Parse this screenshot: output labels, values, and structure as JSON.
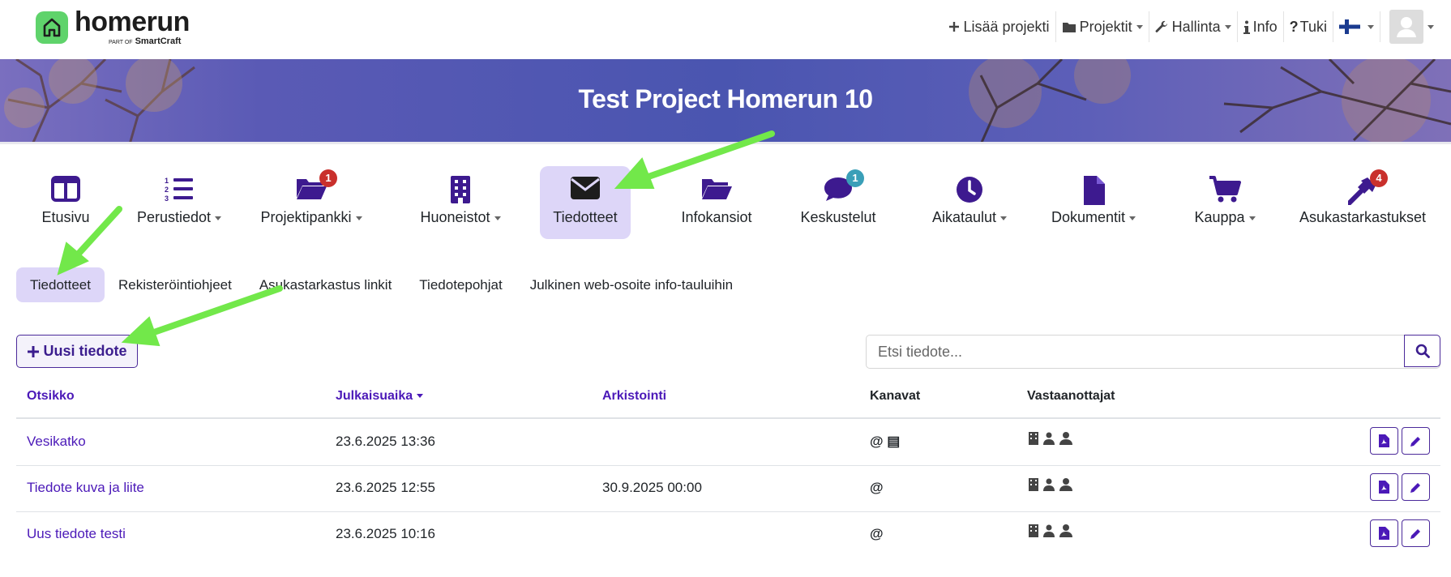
{
  "brand": {
    "name": "homerun",
    "part_of": "PART OF",
    "parent": "SmartCraft"
  },
  "topnav": {
    "add_project": "Lisää projekti",
    "projects": "Projektit",
    "admin": "Hallinta",
    "info": "Info",
    "support": "Tuki",
    "language_icon": "finland-flag-icon",
    "user_icon": "user-avatar-icon"
  },
  "project_title": "Test Project Homerun 10",
  "modules": [
    {
      "label": "Etusivu",
      "icon": "columns-icon",
      "dropdown": false
    },
    {
      "label": "Perustiedot",
      "icon": "numbered-list-icon",
      "dropdown": true
    },
    {
      "label": "Projektipankki",
      "icon": "folder-open-icon",
      "dropdown": true,
      "badge": "1"
    },
    {
      "label": "Huoneistot",
      "icon": "building-icon",
      "dropdown": true
    },
    {
      "label": "Tiedotteet",
      "icon": "envelope-icon",
      "dropdown": false,
      "active": true
    },
    {
      "label": "Infokansiot",
      "icon": "folder-open-icon",
      "dropdown": false
    },
    {
      "label": "Keskustelut",
      "icon": "comment-icon",
      "dropdown": false,
      "badge": "1"
    },
    {
      "label": "Aikataulut",
      "icon": "clock-icon",
      "dropdown": true
    },
    {
      "label": "Dokumentit",
      "icon": "file-icon",
      "dropdown": true
    },
    {
      "label": "Kauppa",
      "icon": "cart-icon",
      "dropdown": true
    },
    {
      "label": "Asukastarkastukset",
      "icon": "hammer-icon",
      "dropdown": false,
      "badge": "4"
    }
  ],
  "subnav": [
    "Tiedotteet",
    "Rekisteröintiohjeet",
    "Asukastarkastus linkit",
    "Tiedotepohjat",
    "Julkinen web-osoite info-tauluihin"
  ],
  "new_button": "Uusi tiedote",
  "search": {
    "placeholder": "Etsi tiedote..."
  },
  "table": {
    "headers": {
      "title": "Otsikko",
      "published": "Julkaisuaika",
      "archive": "Arkistointi",
      "channels": "Kanavat",
      "recipients": "Vastaanottajat"
    },
    "rows": [
      {
        "title": "Vesikatko",
        "published": "23.6.2025 13:36",
        "archive": "",
        "channels": "@ ▤"
      },
      {
        "title": "Tiedote kuva ja liite",
        "published": "23.6.2025 12:55",
        "archive": "30.9.2025 00:00",
        "channels": "@"
      },
      {
        "title": "Uus tiedote testi",
        "published": "23.6.2025 10:16",
        "archive": "",
        "channels": "@"
      }
    ]
  },
  "colors": {
    "accent": "#4b19b8",
    "active_bg": "#ddd6f8",
    "arrow": "#72e84a",
    "badge_red": "#c9302c",
    "badge_teal": "#3a9fb8"
  }
}
